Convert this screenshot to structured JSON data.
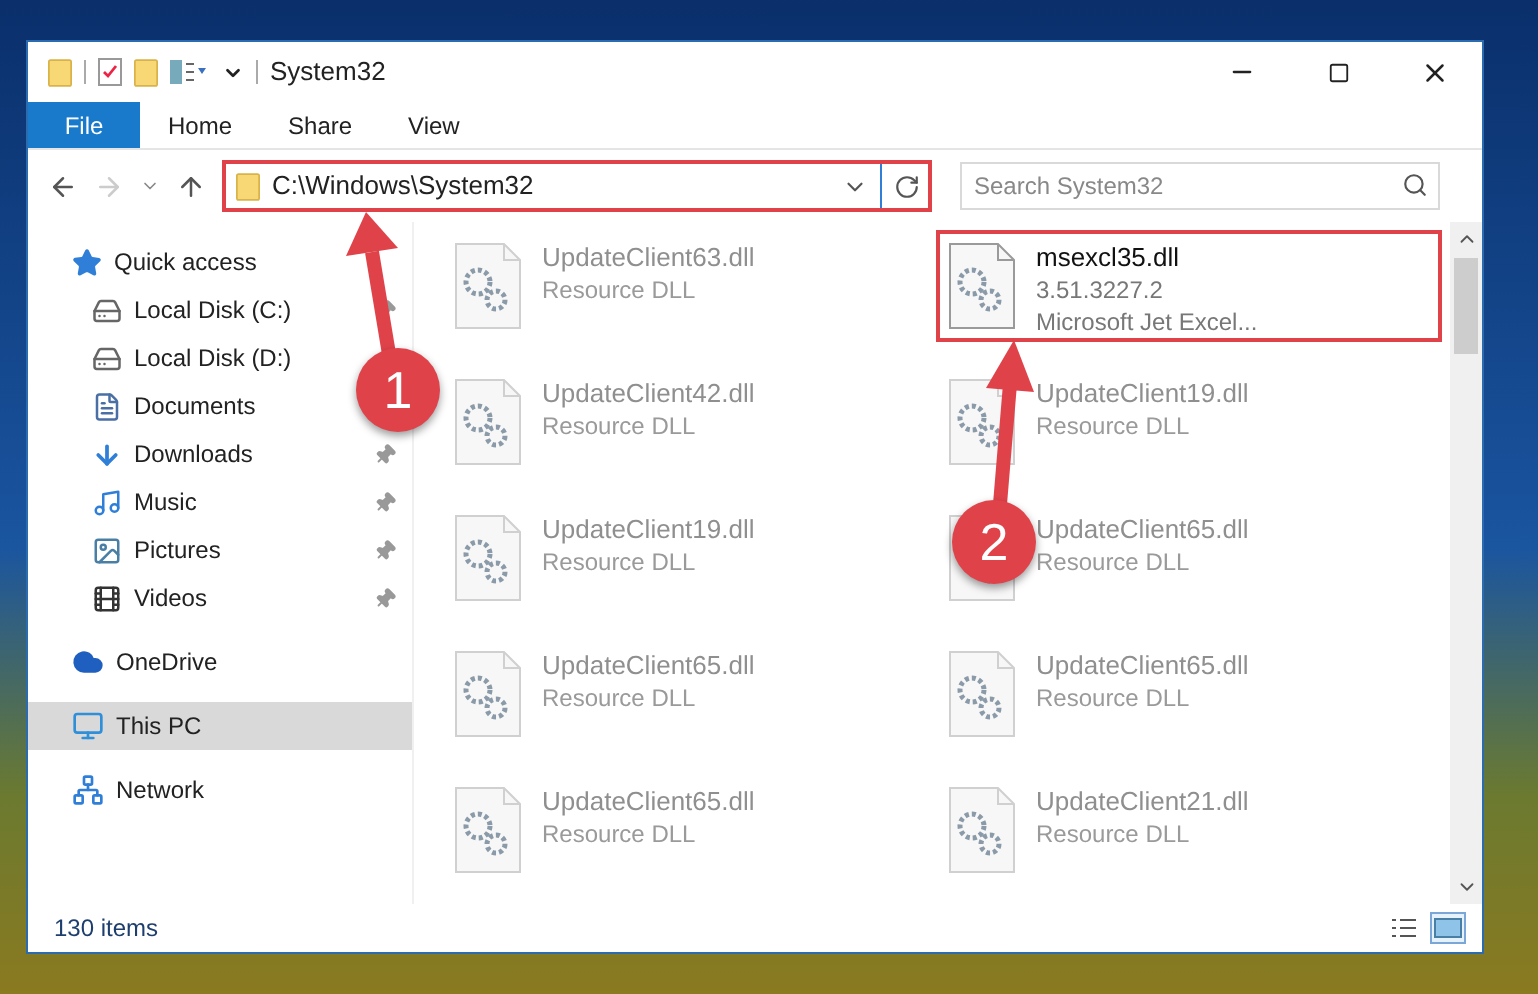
{
  "window": {
    "title": "System32"
  },
  "ribbon_tabs": [
    {
      "label": "File",
      "kind": "file",
      "selected": false
    },
    {
      "label": "Home",
      "kind": "tab",
      "selected": false
    },
    {
      "label": "Share",
      "kind": "tab",
      "selected": false
    },
    {
      "label": "View",
      "kind": "tab",
      "selected": false
    }
  ],
  "address": {
    "path": "C:\\Windows\\System32",
    "highlighted": true
  },
  "search": {
    "placeholder": "Search System32"
  },
  "sidebar": {
    "items": [
      {
        "label": "Quick access",
        "selected": false,
        "children": [
          {
            "label": "Local Disk (C:)",
            "pinned": true
          },
          {
            "label": "Local Disk (D:)"
          },
          {
            "label": "Documents"
          },
          {
            "label": "Downloads",
            "pinned": true
          },
          {
            "label": "Music",
            "pinned": true
          },
          {
            "label": "Pictures",
            "pinned": true
          },
          {
            "label": "Videos",
            "pinned": true
          }
        ]
      },
      {
        "label": "OneDrive",
        "selected": false
      },
      {
        "label": "This PC",
        "selected": true
      },
      {
        "label": "Network",
        "selected": false
      }
    ]
  },
  "files": [
    {
      "name": "UpdateClient63.dll",
      "details": [
        "Resource DLL"
      ],
      "blurred": true,
      "highlighted": false
    },
    {
      "name": "msexcl35.dll",
      "details": [
        "3.51.3227.2",
        "Microsoft Jet Excel..."
      ],
      "blurred": false,
      "highlighted": true
    },
    {
      "name": "UpdateClient42.dll",
      "details": [
        "Resource DLL"
      ],
      "blurred": true,
      "highlighted": false
    },
    {
      "name": "UpdateClient19.dll",
      "details": [
        "Resource DLL"
      ],
      "blurred": true,
      "highlighted": false
    },
    {
      "name": "UpdateClient19.dll",
      "details": [
        "Resource DLL"
      ],
      "blurred": true,
      "highlighted": false
    },
    {
      "name": "UpdateClient65.dll",
      "details": [
        "Resource DLL"
      ],
      "blurred": true,
      "highlighted": false
    },
    {
      "name": "UpdateClient65.dll",
      "details": [
        "Resource DLL"
      ],
      "blurred": true,
      "highlighted": false
    },
    {
      "name": "UpdateClient65.dll",
      "details": [
        "Resource DLL"
      ],
      "blurred": true,
      "highlighted": false
    },
    {
      "name": "UpdateClient65.dll",
      "details": [
        "Resource DLL"
      ],
      "blurred": true,
      "highlighted": false
    },
    {
      "name": "UpdateClient21.dll",
      "details": [
        "Resource DLL"
      ],
      "blurred": true,
      "highlighted": false
    }
  ],
  "status_bar": {
    "item_count": "130 items",
    "view_buttons": [
      {
        "selected": false
      },
      {
        "selected": true
      }
    ]
  },
  "annotations": [
    {
      "label": "1"
    },
    {
      "label": "2"
    }
  ]
}
